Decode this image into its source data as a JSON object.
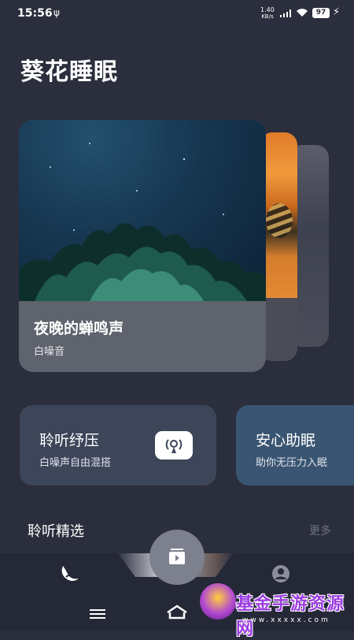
{
  "status_bar": {
    "time": "15:56",
    "usb_icon": "usb-icon",
    "net_speed": "1.40",
    "net_unit": "KB/s",
    "battery": "97",
    "icons": [
      "signal-icon",
      "wifi-icon",
      "battery-icon",
      "charging-icon"
    ]
  },
  "page": {
    "title": "葵花睡眠"
  },
  "featured": {
    "title": "夜晚的蝉鸣声",
    "subtitle": "白噪音"
  },
  "tiles": [
    {
      "title": "聆听纾压",
      "subtitle": "白噪声自由混搭",
      "icon": "radio-broadcast-icon"
    },
    {
      "title": "安心助眠",
      "subtitle": "助你无压力入眠"
    }
  ],
  "section": {
    "title": "聆听精选",
    "more": "更多"
  },
  "bottom_nav": {
    "items": [
      "moon-icon",
      "play-library-icon",
      "profile-icon"
    ]
  },
  "system_nav": {
    "items": [
      "menu-icon",
      "home-icon"
    ]
  },
  "watermark": {
    "text": "基金手游资源网",
    "url": "www.xxxxx.com"
  },
  "colors": {
    "background": "#2b2e3c",
    "card": "#5e636d",
    "tile_1": "#3d4559",
    "tile_2": "#3a5572",
    "nav": "#252836",
    "fab": "#7d808d",
    "muted_text": "#6e7285"
  }
}
